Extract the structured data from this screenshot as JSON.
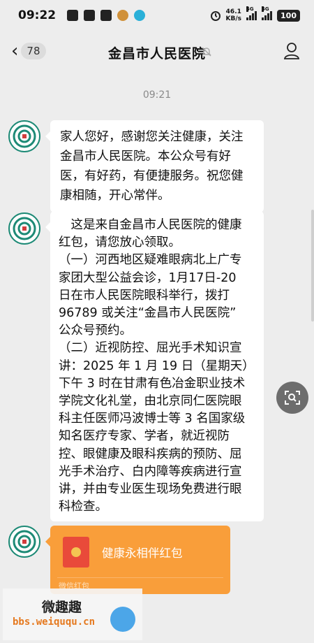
{
  "status_bar": {
    "time": "09:22",
    "net_speed_value": "46.1",
    "net_speed_unit": "KB/s",
    "sim1": "5G",
    "sim2": "5G",
    "battery": "100"
  },
  "header": {
    "unread_count": "78",
    "title": "金昌市人民医院"
  },
  "chat": {
    "timestamp": "09:21",
    "messages": [
      {
        "lines": [
          "家人您好，感谢您关注健康，关注",
          "金昌市人民医院。本公众号有好",
          "医，有好药，有便捷服务。祝您健",
          "康相随，开心常伴。"
        ]
      },
      {
        "lines": [
          "　这是来自金昌市人民医院的健康",
          "红包，请您放心领取。",
          "（一）河西地区疑难眼病北上广专",
          "家团大型公益会诊，1月17日-20",
          "日在市人民医院眼科举行，拨打",
          "96789 或关注“金昌市人民医院”",
          "公众号预约。",
          "（二）近视防控、屈光手术知识宣",
          "讲：2025 年 1 月 19 日（星期天）",
          "下午 3 时在甘肃有色冶金职业技术",
          "学院文化礼堂，由北京同仁医院眼",
          "科主任医师冯波博士等 3 名国家级",
          "知名医疗专家、学者，就近视防",
          "控、眼健康及眼科疾病的预防、屈",
          "光手术治疗、白内障等疾病进行宣",
          "讲，并由专业医生现场免费进行眼",
          "科检查。"
        ]
      }
    ],
    "red_packet": {
      "title": "健康永相伴红包",
      "footer": "微信红包"
    }
  },
  "watermark": {
    "title": "微趣趣",
    "url": "bbs.weiququ.cn"
  },
  "colors": {
    "background": "#ededed",
    "red_packet": "#f99e3a",
    "hospital_logo": "#1d8a76"
  }
}
